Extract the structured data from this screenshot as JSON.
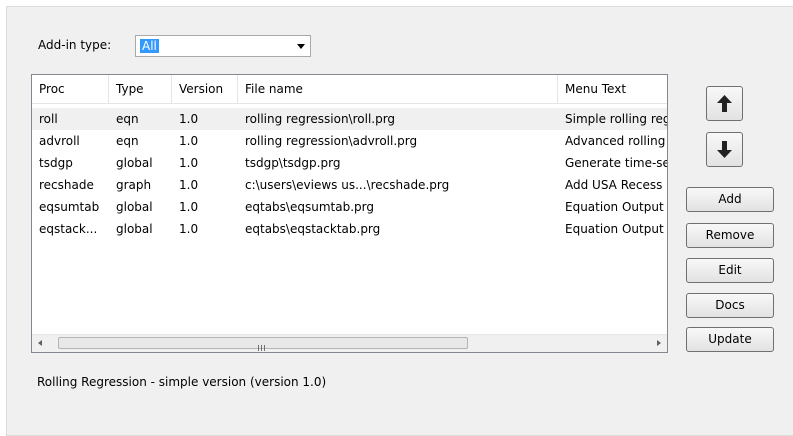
{
  "addin_type": {
    "label": "Add-in type:",
    "value": "All"
  },
  "list": {
    "columns": [
      "Proc",
      "Type",
      "Version",
      "File name",
      "Menu Text"
    ],
    "rows": [
      [
        "roll",
        "eqn",
        "1.0",
        "rolling regression\\roll.prg",
        "Simple rolling reg"
      ],
      [
        "advroll",
        "eqn",
        "1.0",
        "rolling regression\\advroll.prg",
        "Advanced rolling"
      ],
      [
        "tsdgp",
        "global",
        "1.0",
        "tsdgp\\tsdgp.prg",
        "Generate time-se"
      ],
      [
        "recshade",
        "graph",
        "1.0",
        "c:\\users\\eviews us...\\recshade.prg",
        "Add USA Recess"
      ],
      [
        "eqsumtab",
        "global",
        "1.0",
        "eqtabs\\eqsumtab.prg",
        "Equation Output"
      ],
      [
        "eqstack...",
        "global",
        "1.0",
        "eqtabs\\eqstacktab.prg",
        "Equation Output"
      ]
    ],
    "selected_row": 0,
    "scrollbar_grip": "III"
  },
  "buttons": {
    "move_up_icon": "arrow-up-icon",
    "move_down_icon": "arrow-down-icon",
    "add": "Add",
    "remove": "Remove",
    "edit": "Edit",
    "docs": "Docs",
    "update": "Update"
  },
  "description": "Rolling Regression - simple version (version 1.0)",
  "colors": {
    "selection": "#3399ff",
    "panel": "#f0f0f0"
  }
}
